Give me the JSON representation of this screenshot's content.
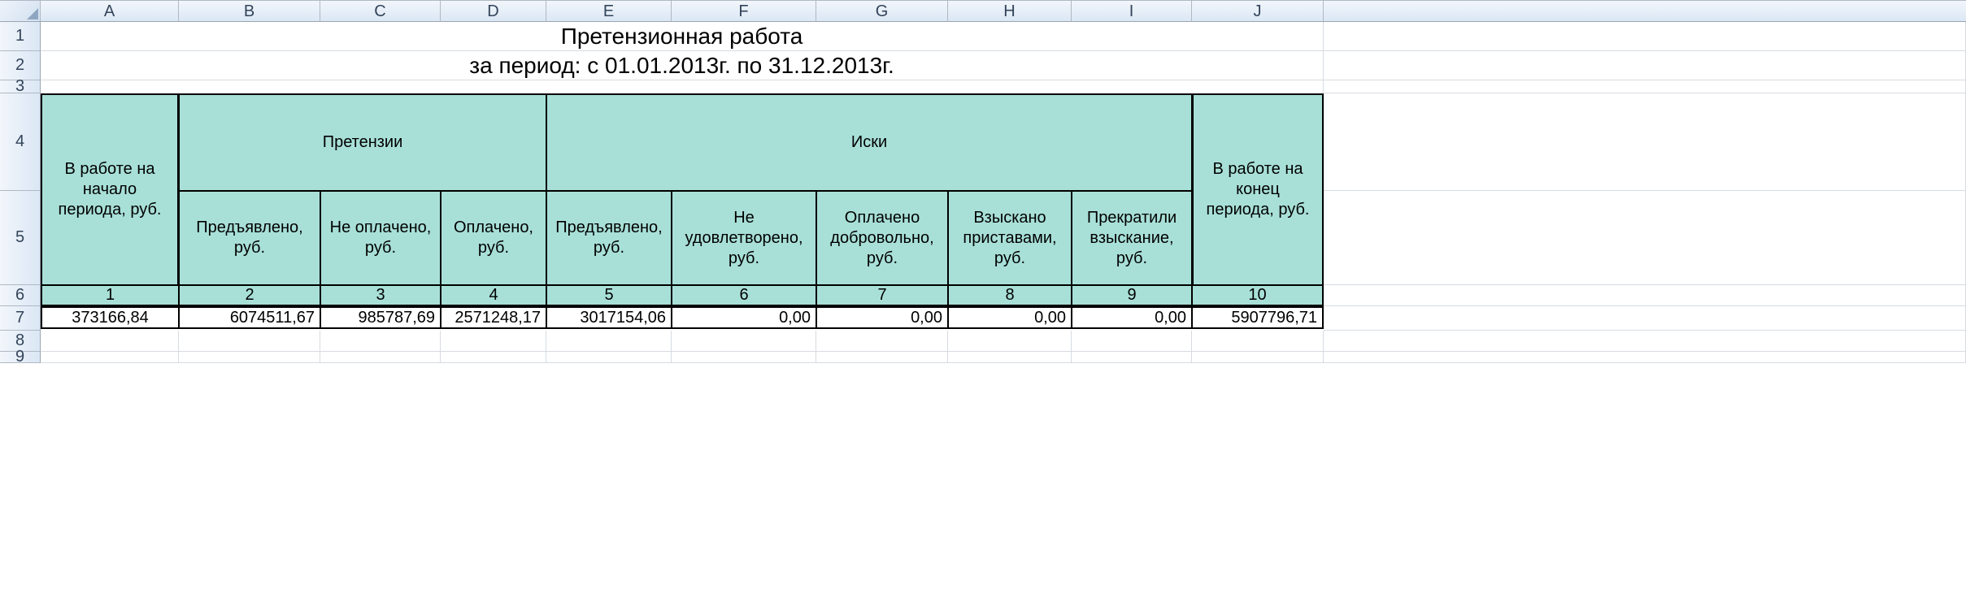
{
  "columns": [
    "A",
    "B",
    "C",
    "D",
    "E",
    "F",
    "G",
    "H",
    "I",
    "J"
  ],
  "rows": [
    "1",
    "2",
    "3",
    "4",
    "5",
    "6",
    "7",
    "8",
    "9"
  ],
  "title": "Претензионная работа",
  "subtitle": "за период: с 01.01.2013г. по 31.12.2013г.",
  "headers": {
    "col_a": "В работе на начало периода, руб.",
    "group_claims": "Претензии",
    "group_lawsuits": "Иски",
    "col_j": "В работе на конец периода, руб.",
    "b": "Предъявлено, руб.",
    "c": "Не оплачено, руб.",
    "d": "Оплачено, руб.",
    "e": "Предъявлено, руб.",
    "f": "Не удовлетворено, руб.",
    "g": "Оплачено добровольно, руб.",
    "h": "Взыскано приставами, руб.",
    "i": "Прекратили взыскание, руб."
  },
  "index_row": [
    "1",
    "2",
    "3",
    "4",
    "5",
    "6",
    "7",
    "8",
    "9",
    "10"
  ],
  "data_row": [
    "373166,84",
    "6074511,67",
    "985787,69",
    "2571248,17",
    "3017154,06",
    "0,00",
    "0,00",
    "0,00",
    "0,00",
    "5907796,71"
  ]
}
